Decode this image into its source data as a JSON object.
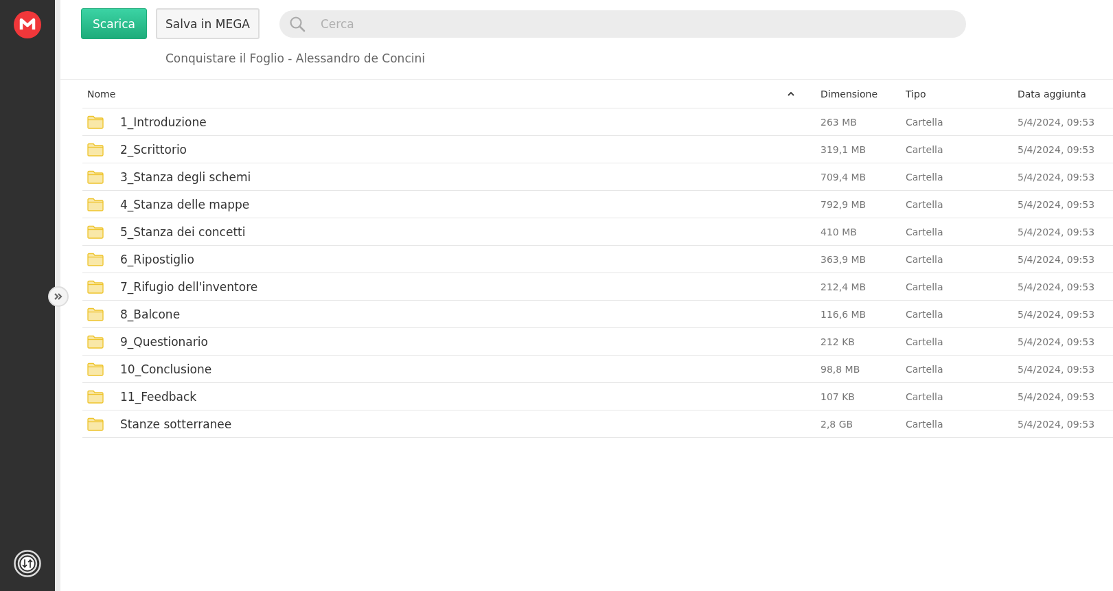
{
  "toolbar": {
    "download_button": "Scarica",
    "save_button": "Salva in MEGA",
    "search": {
      "placeholder": "Cerca"
    }
  },
  "folder_title": "Conquistare il Foglio - Alessandro de Concini",
  "table": {
    "columns": [
      "Nome",
      "Dimensione",
      "Tipo",
      "Data aggiunta"
    ],
    "rows": [
      {
        "name": "1_Introduzione",
        "size": "263 MB",
        "type": "Cartella",
        "date": "5/4/2024, 09:53"
      },
      {
        "name": "2_Scrittorio",
        "size": "319,1 MB",
        "type": "Cartella",
        "date": "5/4/2024, 09:53"
      },
      {
        "name": "3_Stanza degli schemi",
        "size": "709,4 MB",
        "type": "Cartella",
        "date": "5/4/2024, 09:53"
      },
      {
        "name": "4_Stanza delle mappe",
        "size": "792,9 MB",
        "type": "Cartella",
        "date": "5/4/2024, 09:53"
      },
      {
        "name": "5_Stanza dei concetti",
        "size": "410 MB",
        "type": "Cartella",
        "date": "5/4/2024, 09:53"
      },
      {
        "name": "6_Ripostiglio",
        "size": "363,9 MB",
        "type": "Cartella",
        "date": "5/4/2024, 09:53"
      },
      {
        "name": "7_Rifugio dell'inventore",
        "size": "212,4 MB",
        "type": "Cartella",
        "date": "5/4/2024, 09:53"
      },
      {
        "name": "8_Balcone",
        "size": "116,6 MB",
        "type": "Cartella",
        "date": "5/4/2024, 09:53"
      },
      {
        "name": "9_Questionario",
        "size": "212 KB",
        "type": "Cartella",
        "date": "5/4/2024, 09:53"
      },
      {
        "name": "10_Conclusione",
        "size": "98,8 MB",
        "type": "Cartella",
        "date": "5/4/2024, 09:53"
      },
      {
        "name": "11_Feedback",
        "size": "107 KB",
        "type": "Cartella",
        "date": "5/4/2024, 09:53"
      },
      {
        "name": "Stanze sotterranee",
        "size": "2,8 GB",
        "type": "Cartella",
        "date": "5/4/2024, 09:53"
      }
    ]
  }
}
